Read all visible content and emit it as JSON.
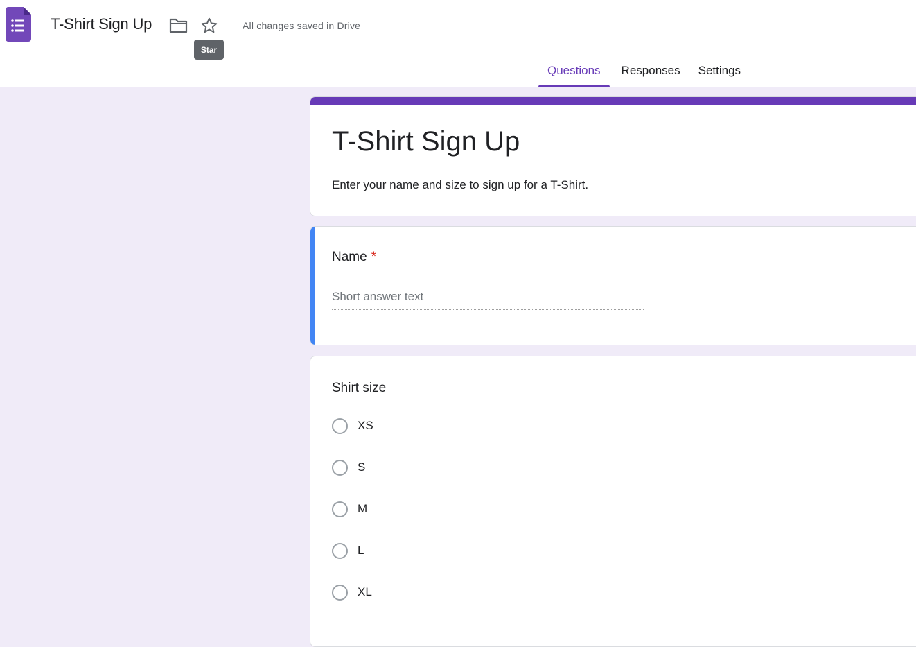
{
  "header": {
    "doc_title": "T-Shirt Sign Up",
    "folder_icon": "folder-icon",
    "star_icon": "star-icon",
    "tooltip": "Star",
    "save_status": "All changes saved in Drive",
    "accent_color": "#673ab7"
  },
  "tabs": [
    {
      "label": "Questions",
      "active": true
    },
    {
      "label": "Responses",
      "active": false
    },
    {
      "label": "Settings",
      "active": false
    }
  ],
  "form": {
    "title": "T-Shirt Sign Up",
    "description": "Enter your name and size to sign up for a T-Shirt."
  },
  "questions": {
    "name": {
      "title": "Name",
      "required_marker": "*",
      "placeholder": "Short answer text"
    },
    "size": {
      "title": "Shirt size",
      "options": [
        "XS",
        "S",
        "M",
        "L",
        "XL"
      ]
    }
  }
}
